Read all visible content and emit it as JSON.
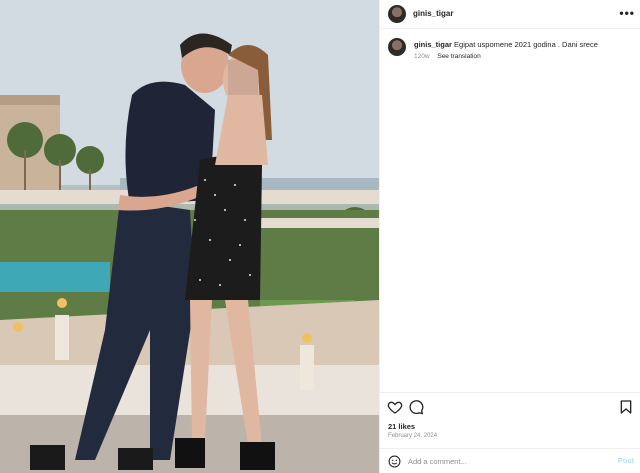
{
  "post": {
    "username": "ginis_tigar",
    "more_icon": "more-horizontal-icon",
    "caption_text": "Egipat uspomene 2021 godina . Dani srece",
    "time_ago": "120w",
    "see_translation": "See translation",
    "likes": "21 likes",
    "date": "February 24, 2024"
  },
  "actions": {
    "like_icon": "heart-icon",
    "comment_icon": "comment-icon",
    "save_icon": "bookmark-icon"
  },
  "comment_box": {
    "emoji_icon": "emoji-icon",
    "placeholder": "Add a comment...",
    "post_label": "Post"
  },
  "colors": {
    "text": "#262626",
    "muted": "#8e8e8e",
    "post_disabled": "#b2dffc",
    "divider": "#efefef"
  }
}
